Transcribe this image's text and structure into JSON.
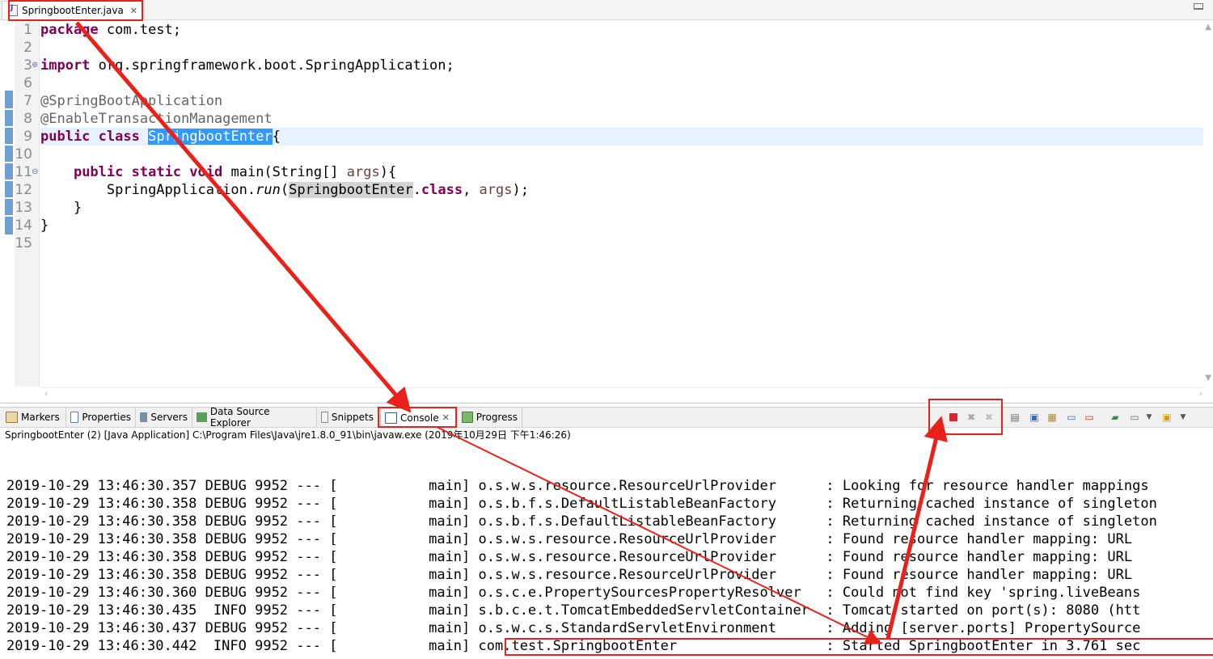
{
  "editor": {
    "tab_label": "SpringbootEnter.java",
    "line_numbers": [
      "1",
      "2",
      "3",
      "6",
      "7",
      "8",
      "9",
      "10",
      "11",
      "12",
      "13",
      "14",
      "15"
    ],
    "code": {
      "l1_kw": "package",
      "l1_rest": " com.test;",
      "l3_kw": "import",
      "l3_rest": " org.springframework.boot.SpringApplication;",
      "l7": "@SpringBootApplication",
      "l8": "@EnableTransactionManagement",
      "l9_kw1": "public",
      "l9_kw2": "class",
      "l9_name": "SpringbootEnter",
      "l9_brace": "{",
      "l11_indent": "    ",
      "l11_kw1": "public",
      "l11_kw2": "static",
      "l11_kw3": "void",
      "l11_sig": " main(String[] ",
      "l11_param": "args",
      "l11_end": "){",
      "l12_indent": "        ",
      "l12_cls": "SpringApplication.",
      "l12_method": "run",
      "l12_open": "(",
      "l12_name": "SpringbootEnter",
      "l12_dot": ".",
      "l12_kw": "class",
      "l12_comma": ", ",
      "l12_param": "args",
      "l12_end": ");",
      "l13": "    }",
      "l14": "}"
    }
  },
  "views": {
    "tabs": [
      {
        "label": "Markers",
        "icon": "markers-icon"
      },
      {
        "label": "Properties",
        "icon": "properties-icon"
      },
      {
        "label": "Servers",
        "icon": "servers-icon"
      },
      {
        "label": "Data Source Explorer",
        "icon": "data-source-icon"
      },
      {
        "label": "Snippets",
        "icon": "snippets-icon"
      },
      {
        "label": "Console",
        "icon": "console-icon"
      },
      {
        "label": "Progress",
        "icon": "progress-icon"
      }
    ],
    "active_tab": "Console"
  },
  "console": {
    "subtitle": "SpringbootEnter (2) [Java Application] C:\\Program Files\\Java\\jre1.8.0_91\\bin\\javaw.exe (2019年10月29日 下午1:46:26)",
    "lines": [
      {
        "ts": "2019-10-29 13:46:30.357",
        "level": "DEBUG",
        "pid": "9952",
        "sep": "---",
        "thread": "[           main]",
        "logger": "o.s.w.s.resource.ResourceUrlProvider     ",
        "msg": ": Looking for resource handler mappings"
      },
      {
        "ts": "2019-10-29 13:46:30.358",
        "level": "DEBUG",
        "pid": "9952",
        "sep": "---",
        "thread": "[           main]",
        "logger": "o.s.b.f.s.DefaultListableBeanFactory     ",
        "msg": ": Returning cached instance of singleton"
      },
      {
        "ts": "2019-10-29 13:46:30.358",
        "level": "DEBUG",
        "pid": "9952",
        "sep": "---",
        "thread": "[           main]",
        "logger": "o.s.b.f.s.DefaultListableBeanFactory     ",
        "msg": ": Returning cached instance of singleton"
      },
      {
        "ts": "2019-10-29 13:46:30.358",
        "level": "DEBUG",
        "pid": "9952",
        "sep": "---",
        "thread": "[           main]",
        "logger": "o.s.w.s.resource.ResourceUrlProvider     ",
        "msg": ": Found resource handler mapping: URL"
      },
      {
        "ts": "2019-10-29 13:46:30.358",
        "level": "DEBUG",
        "pid": "9952",
        "sep": "---",
        "thread": "[           main]",
        "logger": "o.s.w.s.resource.ResourceUrlProvider     ",
        "msg": ": Found resource handler mapping: URL"
      },
      {
        "ts": "2019-10-29 13:46:30.358",
        "level": "DEBUG",
        "pid": "9952",
        "sep": "---",
        "thread": "[           main]",
        "logger": "o.s.w.s.resource.ResourceUrlProvider     ",
        "msg": ": Found resource handler mapping: URL"
      },
      {
        "ts": "2019-10-29 13:46:30.360",
        "level": "DEBUG",
        "pid": "9952",
        "sep": "---",
        "thread": "[           main]",
        "logger": "o.s.c.e.PropertySourcesPropertyResolver  ",
        "msg": ": Could not find key 'spring.liveBeans"
      },
      {
        "ts": "2019-10-29 13:46:30.435",
        "level": " INFO",
        "pid": "9952",
        "sep": "---",
        "thread": "[           main]",
        "logger": "s.b.c.e.t.TomcatEmbeddedServletContainer ",
        "msg": ": Tomcat started on port(s): 8080 (htt"
      },
      {
        "ts": "2019-10-29 13:46:30.437",
        "level": "DEBUG",
        "pid": "9952",
        "sep": "---",
        "thread": "[           main]",
        "logger": "o.s.w.c.s.StandardServletEnvironment     ",
        "msg": ": Adding [server.ports] PropertySource"
      },
      {
        "ts": "2019-10-29 13:46:30.442",
        "level": " INFO",
        "pid": "9952",
        "sep": "---",
        "thread": "[           main]",
        "logger": "com.test.SpringbootEnter                 ",
        "msg": ": Started SpringbootEnter in 3.761 sec"
      }
    ]
  },
  "toolbar": {
    "icons": [
      "terminate-icon",
      "remove-launch-icon",
      "remove-all-terminated-icon",
      "scroll-lock-icon",
      "show-on-stdout-icon",
      "show-on-stderr-icon",
      "pin-console-icon",
      "display-console-icon",
      "open-console-icon",
      "view-menu-icon"
    ]
  },
  "colors": {
    "annotation_red": "#e8221a",
    "keyword": "#7f0055",
    "selection": "#3399ff"
  }
}
